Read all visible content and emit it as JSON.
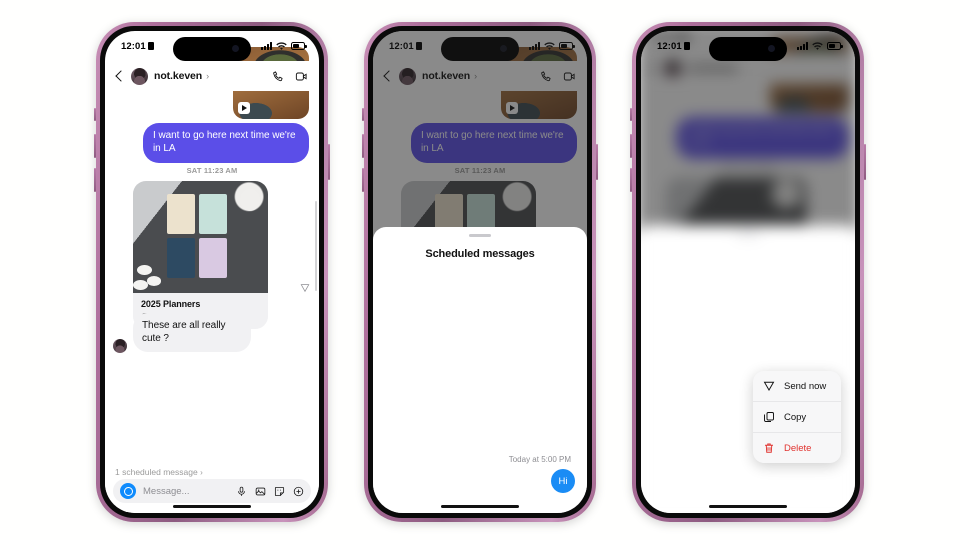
{
  "status_bar": {
    "time": "12:01",
    "lock_icon": "lock-portrait-icon",
    "signal_icon": "cellular-signal-icon",
    "wifi_icon": "wifi-icon",
    "battery_icon": "battery-icon"
  },
  "chat": {
    "back_icon": "back-chevron-icon",
    "avatar": "profile-avatar",
    "handle": "not.keven",
    "handle_chevron": "›",
    "call_icon": "phone-call-icon",
    "video_icon": "video-call-icon",
    "media": {
      "reel_icon": "reel-play-icon",
      "reaction": "〜"
    },
    "outgoing_message": "I want to go here next time we're in LA",
    "day_stamp": "SAT 11:23 AM",
    "link_card": {
      "title": "2025 Planners",
      "url": "mochithings.com",
      "globe_icon": "globe-icon"
    },
    "send_indicator_icon": "send-paper-plane-icon",
    "incoming_message": "These are all really cute ?",
    "scheduled_row": {
      "label": "1 scheduled message",
      "chevron": "›"
    },
    "composer": {
      "camera_icon": "camera-icon",
      "placeholder": "Message...",
      "mic_icon": "microphone-icon",
      "photo_icon": "photo-library-icon",
      "sticker_icon": "sticker-icon",
      "plus_icon": "plus-circle-icon"
    }
  },
  "sheet": {
    "grabber": "sheet-grabber",
    "title": "Scheduled messages",
    "scheduled_time": "Today at 5:00 PM",
    "message_text": "Hi"
  },
  "context_menu": {
    "items": [
      {
        "label": "Send now",
        "icon": "send-paper-plane-icon",
        "danger": false
      },
      {
        "label": "Copy",
        "icon": "copy-icon",
        "danger": false
      },
      {
        "label": "Delete",
        "icon": "trash-icon",
        "danger": true
      }
    ],
    "message_text": "Hi"
  },
  "colors": {
    "outgoing_bubble": "#5b4ee8",
    "incoming_bubble": "#f1f1f3",
    "scheduled_bubble": "#1a8cf5",
    "danger": "#e0332f",
    "frame": "#b97fa8"
  }
}
